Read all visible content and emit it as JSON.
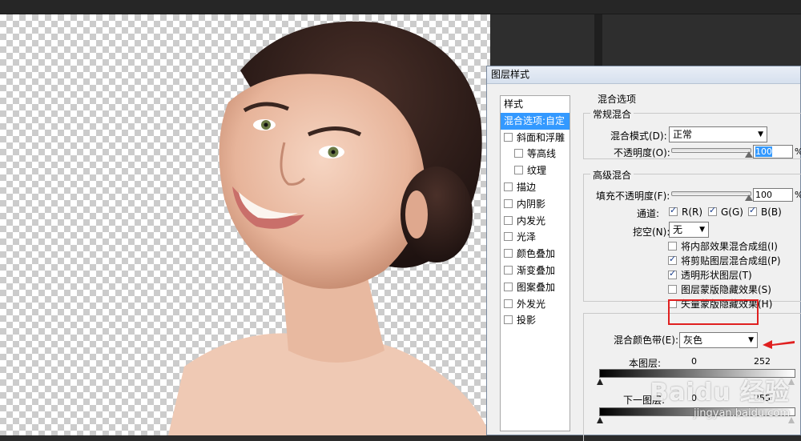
{
  "dialog": {
    "title": "图层样式"
  },
  "styles": {
    "items": [
      {
        "label": "样式",
        "checkbox": false,
        "checked": false,
        "selected": false,
        "sub": false
      },
      {
        "label": "混合选项:自定",
        "checkbox": false,
        "checked": false,
        "selected": true,
        "sub": false
      },
      {
        "label": "斜面和浮雕",
        "checkbox": true,
        "checked": false,
        "selected": false,
        "sub": false
      },
      {
        "label": "等高线",
        "checkbox": true,
        "checked": false,
        "selected": false,
        "sub": true
      },
      {
        "label": "纹理",
        "checkbox": true,
        "checked": false,
        "selected": false,
        "sub": true
      },
      {
        "label": "描边",
        "checkbox": true,
        "checked": false,
        "selected": false,
        "sub": false
      },
      {
        "label": "内阴影",
        "checkbox": true,
        "checked": false,
        "selected": false,
        "sub": false
      },
      {
        "label": "内发光",
        "checkbox": true,
        "checked": false,
        "selected": false,
        "sub": false
      },
      {
        "label": "光泽",
        "checkbox": true,
        "checked": false,
        "selected": false,
        "sub": false
      },
      {
        "label": "颜色叠加",
        "checkbox": true,
        "checked": false,
        "selected": false,
        "sub": false
      },
      {
        "label": "渐变叠加",
        "checkbox": true,
        "checked": false,
        "selected": false,
        "sub": false
      },
      {
        "label": "图案叠加",
        "checkbox": true,
        "checked": false,
        "selected": false,
        "sub": false
      },
      {
        "label": "外发光",
        "checkbox": true,
        "checked": false,
        "selected": false,
        "sub": false
      },
      {
        "label": "投影",
        "checkbox": true,
        "checked": false,
        "selected": false,
        "sub": false
      }
    ]
  },
  "blending": {
    "section_title": "混合选项",
    "general": {
      "legend": "常规混合",
      "mode_label": "混合模式(D):",
      "mode_value": "正常",
      "opacity_label": "不透明度(O):",
      "opacity_value": "100",
      "opacity_fraction": 1.0,
      "unit": "%"
    },
    "advanced": {
      "legend": "高级混合",
      "fill_label": "填充不透明度(F):",
      "fill_value": "100",
      "fill_fraction": 1.0,
      "unit": "%",
      "channels_label": "通道:",
      "channels": [
        {
          "label": "R(R)",
          "checked": true
        },
        {
          "label": "G(G)",
          "checked": true
        },
        {
          "label": "B(B)",
          "checked": true
        }
      ],
      "knockout_label": "挖空(N):",
      "knockout_value": "无",
      "options": [
        {
          "label": "将内部效果混合成组(I)",
          "checked": false
        },
        {
          "label": "将剪贴图层混合成组(P)",
          "checked": true
        },
        {
          "label": "透明形状图层(T)",
          "checked": true
        },
        {
          "label": "图层蒙版隐藏效果(S)",
          "checked": false
        },
        {
          "label": "矢量蒙版隐藏效果(H)",
          "checked": false
        }
      ]
    },
    "blend_if": {
      "label": "混合颜色带(E):",
      "value": "灰色",
      "this_layer_label": "本图层:",
      "this_layer_low": "0",
      "this_layer_high": "252",
      "underlying_label": "下一图层:",
      "underlying_low": "0",
      "underlying_high": "255"
    }
  },
  "watermark": {
    "logo": "Baidu 经验",
    "url": "jingyan.baidu.com"
  },
  "colors": {
    "selection": "#3399ff",
    "highlight_box": "#e02020"
  }
}
